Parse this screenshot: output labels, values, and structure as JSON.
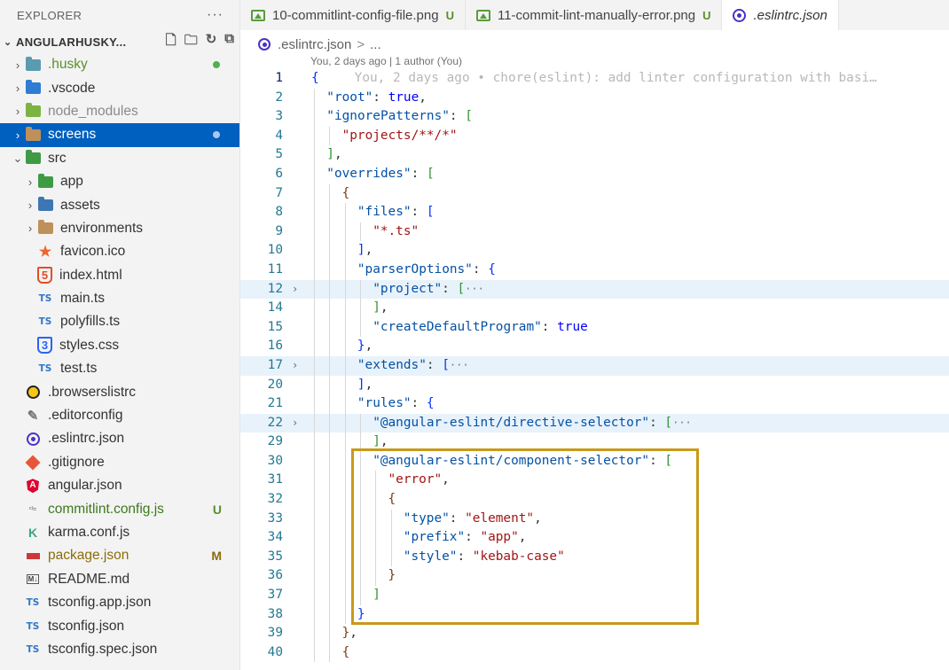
{
  "explorer": {
    "title": "EXPLORER",
    "more": "···",
    "project": "ANGULARHUSKY...",
    "items": [
      {
        "label": "husky_dir",
        "text": ".husky",
        "depth": 0,
        "chev": "›",
        "icon": "husky-folder-icon",
        "dot": "#4fb04f",
        "color": "#5a8f2b"
      },
      {
        "label": "vscode_dir",
        "text": ".vscode",
        "depth": 0,
        "chev": "›",
        "icon": "vscode-folder-icon"
      },
      {
        "label": "node_modules",
        "text": "node_modules",
        "depth": 0,
        "chev": "›",
        "icon": "node-folder-icon",
        "color": "#8a8a8a"
      },
      {
        "label": "screens",
        "text": "screens",
        "depth": 0,
        "chev": "›",
        "icon": "folder-icon",
        "dot": "#a9c8f0",
        "selected": true
      },
      {
        "label": "src",
        "text": "src",
        "depth": 0,
        "chev": "⌄",
        "icon": "src-folder-icon"
      },
      {
        "label": "app",
        "text": "app",
        "depth": 1,
        "chev": "›",
        "icon": "app-folder-icon"
      },
      {
        "label": "assets",
        "text": "assets",
        "depth": 1,
        "chev": "›",
        "icon": "assets-folder-icon"
      },
      {
        "label": "environments",
        "text": "environments",
        "depth": 1,
        "chev": "›",
        "icon": "folder-icon"
      },
      {
        "label": "favicon",
        "text": "favicon.ico",
        "depth": 1,
        "icon": "star-icon"
      },
      {
        "label": "index_html",
        "text": "index.html",
        "depth": 1,
        "icon": "html-icon"
      },
      {
        "label": "main_ts",
        "text": "main.ts",
        "depth": 1,
        "icon": "typescript-icon"
      },
      {
        "label": "polyfills_ts",
        "text": "polyfills.ts",
        "depth": 1,
        "icon": "typescript-icon"
      },
      {
        "label": "styles_css",
        "text": "styles.css",
        "depth": 1,
        "icon": "css-icon"
      },
      {
        "label": "test_ts",
        "text": "test.ts",
        "depth": 1,
        "icon": "typescript-icon"
      },
      {
        "label": "browserslistrc",
        "text": ".browserslistrc",
        "depth": 0,
        "icon": "browserslist-icon"
      },
      {
        "label": "editorconfig",
        "text": ".editorconfig",
        "depth": 0,
        "icon": "editorconfig-icon"
      },
      {
        "label": "eslintrc",
        "text": ".eslintrc.json",
        "depth": 0,
        "icon": "eslint-icon"
      },
      {
        "label": "gitignore",
        "text": ".gitignore",
        "depth": 0,
        "icon": "git-icon"
      },
      {
        "label": "angular_json",
        "text": "angular.json",
        "depth": 0,
        "icon": "angular-icon"
      },
      {
        "label": "commitlint",
        "text": "commitlint.config.js",
        "depth": 0,
        "icon": "commitlint-icon",
        "badge": "U",
        "color": "#3c7a1e",
        "badgeColor": "#5a8f2b"
      },
      {
        "label": "karma",
        "text": "karma.conf.js",
        "depth": 0,
        "icon": "karma-icon"
      },
      {
        "label": "package_json",
        "text": "package.json",
        "depth": 0,
        "icon": "npm-icon",
        "badge": "M",
        "color": "#8a6d0a",
        "badgeColor": "#8a6d0a"
      },
      {
        "label": "readme",
        "text": "README.md",
        "depth": 0,
        "icon": "markdown-icon"
      },
      {
        "label": "tsconfig_app",
        "text": "tsconfig.app.json",
        "depth": 0,
        "icon": "tsconfig-icon"
      },
      {
        "label": "tsconfig",
        "text": "tsconfig.json",
        "depth": 0,
        "icon": "tsconfig-icon"
      },
      {
        "label": "tsconfig_spec",
        "text": "tsconfig.spec.json",
        "depth": 0,
        "icon": "tsconfig-icon"
      }
    ]
  },
  "tabs": [
    {
      "label": "10-commitlint-config-file.png",
      "status": "U",
      "icon": "image-icon"
    },
    {
      "label": "11-commit-lint-manually-error.png",
      "status": "U",
      "icon": "image-icon"
    },
    {
      "label": ".eslintrc.json",
      "status": "",
      "icon": "eslint-icon",
      "active": true
    }
  ],
  "breadcrumb": {
    "file": ".eslintrc.json",
    "sep": ">",
    "more": "..."
  },
  "codelens": "You, 2 days ago | 1 author (You)",
  "colors": {
    "accent": "#0060c0",
    "highlight_box": "#c89a1a",
    "added": "#5a8f2b",
    "modified": "#8a6d0a"
  },
  "code_lines": [
    {
      "n": "1",
      "cur": true,
      "i": 0,
      "t": [
        [
          "br1",
          "{"
        ],
        [
          "ghost",
          "You, 2 days ago • chore(eslint): add linter configuration with basi…"
        ]
      ]
    },
    {
      "n": "2",
      "i": 1,
      "t": [
        [
          "k",
          "\"root\""
        ],
        [
          "p",
          ": "
        ],
        [
          "b",
          "true"
        ],
        [
          "p",
          ","
        ]
      ]
    },
    {
      "n": "3",
      "i": 1,
      "t": [
        [
          "k",
          "\"ignorePatterns\""
        ],
        [
          "p",
          ": "
        ],
        [
          "br2",
          "["
        ]
      ]
    },
    {
      "n": "4",
      "i": 2,
      "t": [
        [
          "s",
          "\"projects/**/*\""
        ]
      ]
    },
    {
      "n": "5",
      "i": 1,
      "t": [
        [
          "br2",
          "]"
        ],
        [
          "p",
          ","
        ]
      ]
    },
    {
      "n": "6",
      "i": 1,
      "t": [
        [
          "k",
          "\"overrides\""
        ],
        [
          "p",
          ": "
        ],
        [
          "br2",
          "["
        ]
      ]
    },
    {
      "n": "7",
      "i": 2,
      "t": [
        [
          "br3",
          "{"
        ]
      ]
    },
    {
      "n": "8",
      "i": 3,
      "t": [
        [
          "k",
          "\"files\""
        ],
        [
          "p",
          ": "
        ],
        [
          "br1",
          "["
        ]
      ]
    },
    {
      "n": "9",
      "i": 4,
      "t": [
        [
          "s",
          "\"*.ts\""
        ]
      ]
    },
    {
      "n": "10",
      "i": 3,
      "t": [
        [
          "br1",
          "]"
        ],
        [
          "p",
          ","
        ]
      ]
    },
    {
      "n": "11",
      "i": 3,
      "t": [
        [
          "k",
          "\"parserOptions\""
        ],
        [
          "p",
          ": "
        ],
        [
          "br1",
          "{"
        ]
      ]
    },
    {
      "n": "12",
      "hl": true,
      "fold": "›",
      "i": 4,
      "t": [
        [
          "k",
          "\"project\""
        ],
        [
          "p",
          ": "
        ],
        [
          "br2",
          "["
        ],
        [
          "ellip",
          "···"
        ]
      ]
    },
    {
      "n": "14",
      "i": 4,
      "t": [
        [
          "br2",
          "]"
        ],
        [
          "p",
          ","
        ]
      ]
    },
    {
      "n": "15",
      "i": 4,
      "t": [
        [
          "k",
          "\"createDefaultProgram\""
        ],
        [
          "p",
          ": "
        ],
        [
          "b",
          "true"
        ]
      ]
    },
    {
      "n": "16",
      "i": 3,
      "t": [
        [
          "br1",
          "}"
        ],
        [
          "p",
          ","
        ]
      ]
    },
    {
      "n": "17",
      "hl": true,
      "fold": "›",
      "i": 3,
      "t": [
        [
          "k",
          "\"extends\""
        ],
        [
          "p",
          ": "
        ],
        [
          "br1",
          "["
        ],
        [
          "ellip",
          "···"
        ]
      ]
    },
    {
      "n": "20",
      "i": 3,
      "t": [
        [
          "br1",
          "]"
        ],
        [
          "p",
          ","
        ]
      ]
    },
    {
      "n": "21",
      "i": 3,
      "t": [
        [
          "k",
          "\"rules\""
        ],
        [
          "p",
          ": "
        ],
        [
          "br1",
          "{"
        ]
      ]
    },
    {
      "n": "22",
      "hl": true,
      "fold": "›",
      "i": 4,
      "t": [
        [
          "k",
          "\"@angular-eslint/directive-selector\""
        ],
        [
          "p",
          ": "
        ],
        [
          "br2",
          "["
        ],
        [
          "ellip",
          "···"
        ]
      ]
    },
    {
      "n": "29",
      "i": 4,
      "t": [
        [
          "br2",
          "]"
        ],
        [
          "p",
          ","
        ]
      ]
    },
    {
      "n": "30",
      "i": 4,
      "t": [
        [
          "k",
          "\"@angular-eslint/component-selector\""
        ],
        [
          "p",
          ": "
        ],
        [
          "br2",
          "["
        ]
      ]
    },
    {
      "n": "31",
      "i": 5,
      "t": [
        [
          "s",
          "\"error\""
        ],
        [
          "p",
          ","
        ]
      ]
    },
    {
      "n": "32",
      "i": 5,
      "t": [
        [
          "br3",
          "{"
        ]
      ]
    },
    {
      "n": "33",
      "i": 6,
      "t": [
        [
          "k",
          "\"type\""
        ],
        [
          "p",
          ": "
        ],
        [
          "s",
          "\"element\""
        ],
        [
          "p",
          ","
        ]
      ]
    },
    {
      "n": "34",
      "i": 6,
      "t": [
        [
          "k",
          "\"prefix\""
        ],
        [
          "p",
          ": "
        ],
        [
          "s",
          "\"app\""
        ],
        [
          "p",
          ","
        ]
      ]
    },
    {
      "n": "35",
      "i": 6,
      "t": [
        [
          "k",
          "\"style\""
        ],
        [
          "p",
          ": "
        ],
        [
          "s",
          "\"kebab-case\""
        ]
      ]
    },
    {
      "n": "36",
      "i": 5,
      "t": [
        [
          "br3",
          "}"
        ]
      ]
    },
    {
      "n": "37",
      "i": 4,
      "t": [
        [
          "br2",
          "]"
        ]
      ]
    },
    {
      "n": "38",
      "i": 3,
      "t": [
        [
          "br1",
          "}"
        ]
      ]
    },
    {
      "n": "39",
      "i": 2,
      "t": [
        [
          "br3",
          "}"
        ],
        [
          "p",
          ","
        ]
      ]
    },
    {
      "n": "40",
      "i": 2,
      "t": [
        [
          "br3",
          "{"
        ]
      ]
    }
  ]
}
